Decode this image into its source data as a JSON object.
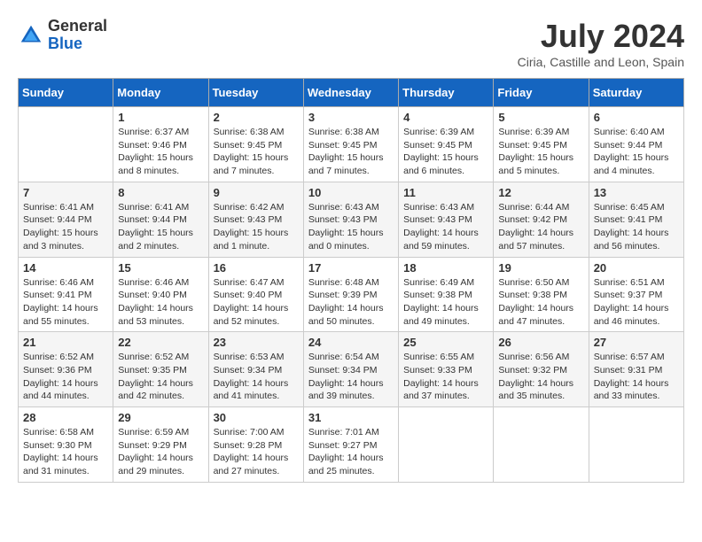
{
  "header": {
    "logo_general": "General",
    "logo_blue": "Blue",
    "month_year": "July 2024",
    "location": "Ciria, Castille and Leon, Spain"
  },
  "days_of_week": [
    "Sunday",
    "Monday",
    "Tuesday",
    "Wednesday",
    "Thursday",
    "Friday",
    "Saturday"
  ],
  "weeks": [
    [
      {
        "day": "",
        "sunrise": "",
        "sunset": "",
        "daylight": ""
      },
      {
        "day": "1",
        "sunrise": "Sunrise: 6:37 AM",
        "sunset": "Sunset: 9:46 PM",
        "daylight": "Daylight: 15 hours and 8 minutes."
      },
      {
        "day": "2",
        "sunrise": "Sunrise: 6:38 AM",
        "sunset": "Sunset: 9:45 PM",
        "daylight": "Daylight: 15 hours and 7 minutes."
      },
      {
        "day": "3",
        "sunrise": "Sunrise: 6:38 AM",
        "sunset": "Sunset: 9:45 PM",
        "daylight": "Daylight: 15 hours and 7 minutes."
      },
      {
        "day": "4",
        "sunrise": "Sunrise: 6:39 AM",
        "sunset": "Sunset: 9:45 PM",
        "daylight": "Daylight: 15 hours and 6 minutes."
      },
      {
        "day": "5",
        "sunrise": "Sunrise: 6:39 AM",
        "sunset": "Sunset: 9:45 PM",
        "daylight": "Daylight: 15 hours and 5 minutes."
      },
      {
        "day": "6",
        "sunrise": "Sunrise: 6:40 AM",
        "sunset": "Sunset: 9:44 PM",
        "daylight": "Daylight: 15 hours and 4 minutes."
      }
    ],
    [
      {
        "day": "7",
        "sunrise": "Sunrise: 6:41 AM",
        "sunset": "Sunset: 9:44 PM",
        "daylight": "Daylight: 15 hours and 3 minutes."
      },
      {
        "day": "8",
        "sunrise": "Sunrise: 6:41 AM",
        "sunset": "Sunset: 9:44 PM",
        "daylight": "Daylight: 15 hours and 2 minutes."
      },
      {
        "day": "9",
        "sunrise": "Sunrise: 6:42 AM",
        "sunset": "Sunset: 9:43 PM",
        "daylight": "Daylight: 15 hours and 1 minute."
      },
      {
        "day": "10",
        "sunrise": "Sunrise: 6:43 AM",
        "sunset": "Sunset: 9:43 PM",
        "daylight": "Daylight: 15 hours and 0 minutes."
      },
      {
        "day": "11",
        "sunrise": "Sunrise: 6:43 AM",
        "sunset": "Sunset: 9:43 PM",
        "daylight": "Daylight: 14 hours and 59 minutes."
      },
      {
        "day": "12",
        "sunrise": "Sunrise: 6:44 AM",
        "sunset": "Sunset: 9:42 PM",
        "daylight": "Daylight: 14 hours and 57 minutes."
      },
      {
        "day": "13",
        "sunrise": "Sunrise: 6:45 AM",
        "sunset": "Sunset: 9:41 PM",
        "daylight": "Daylight: 14 hours and 56 minutes."
      }
    ],
    [
      {
        "day": "14",
        "sunrise": "Sunrise: 6:46 AM",
        "sunset": "Sunset: 9:41 PM",
        "daylight": "Daylight: 14 hours and 55 minutes."
      },
      {
        "day": "15",
        "sunrise": "Sunrise: 6:46 AM",
        "sunset": "Sunset: 9:40 PM",
        "daylight": "Daylight: 14 hours and 53 minutes."
      },
      {
        "day": "16",
        "sunrise": "Sunrise: 6:47 AM",
        "sunset": "Sunset: 9:40 PM",
        "daylight": "Daylight: 14 hours and 52 minutes."
      },
      {
        "day": "17",
        "sunrise": "Sunrise: 6:48 AM",
        "sunset": "Sunset: 9:39 PM",
        "daylight": "Daylight: 14 hours and 50 minutes."
      },
      {
        "day": "18",
        "sunrise": "Sunrise: 6:49 AM",
        "sunset": "Sunset: 9:38 PM",
        "daylight": "Daylight: 14 hours and 49 minutes."
      },
      {
        "day": "19",
        "sunrise": "Sunrise: 6:50 AM",
        "sunset": "Sunset: 9:38 PM",
        "daylight": "Daylight: 14 hours and 47 minutes."
      },
      {
        "day": "20",
        "sunrise": "Sunrise: 6:51 AM",
        "sunset": "Sunset: 9:37 PM",
        "daylight": "Daylight: 14 hours and 46 minutes."
      }
    ],
    [
      {
        "day": "21",
        "sunrise": "Sunrise: 6:52 AM",
        "sunset": "Sunset: 9:36 PM",
        "daylight": "Daylight: 14 hours and 44 minutes."
      },
      {
        "day": "22",
        "sunrise": "Sunrise: 6:52 AM",
        "sunset": "Sunset: 9:35 PM",
        "daylight": "Daylight: 14 hours and 42 minutes."
      },
      {
        "day": "23",
        "sunrise": "Sunrise: 6:53 AM",
        "sunset": "Sunset: 9:34 PM",
        "daylight": "Daylight: 14 hours and 41 minutes."
      },
      {
        "day": "24",
        "sunrise": "Sunrise: 6:54 AM",
        "sunset": "Sunset: 9:34 PM",
        "daylight": "Daylight: 14 hours and 39 minutes."
      },
      {
        "day": "25",
        "sunrise": "Sunrise: 6:55 AM",
        "sunset": "Sunset: 9:33 PM",
        "daylight": "Daylight: 14 hours and 37 minutes."
      },
      {
        "day": "26",
        "sunrise": "Sunrise: 6:56 AM",
        "sunset": "Sunset: 9:32 PM",
        "daylight": "Daylight: 14 hours and 35 minutes."
      },
      {
        "day": "27",
        "sunrise": "Sunrise: 6:57 AM",
        "sunset": "Sunset: 9:31 PM",
        "daylight": "Daylight: 14 hours and 33 minutes."
      }
    ],
    [
      {
        "day": "28",
        "sunrise": "Sunrise: 6:58 AM",
        "sunset": "Sunset: 9:30 PM",
        "daylight": "Daylight: 14 hours and 31 minutes."
      },
      {
        "day": "29",
        "sunrise": "Sunrise: 6:59 AM",
        "sunset": "Sunset: 9:29 PM",
        "daylight": "Daylight: 14 hours and 29 minutes."
      },
      {
        "day": "30",
        "sunrise": "Sunrise: 7:00 AM",
        "sunset": "Sunset: 9:28 PM",
        "daylight": "Daylight: 14 hours and 27 minutes."
      },
      {
        "day": "31",
        "sunrise": "Sunrise: 7:01 AM",
        "sunset": "Sunset: 9:27 PM",
        "daylight": "Daylight: 14 hours and 25 minutes."
      },
      {
        "day": "",
        "sunrise": "",
        "sunset": "",
        "daylight": ""
      },
      {
        "day": "",
        "sunrise": "",
        "sunset": "",
        "daylight": ""
      },
      {
        "day": "",
        "sunrise": "",
        "sunset": "",
        "daylight": ""
      }
    ]
  ]
}
